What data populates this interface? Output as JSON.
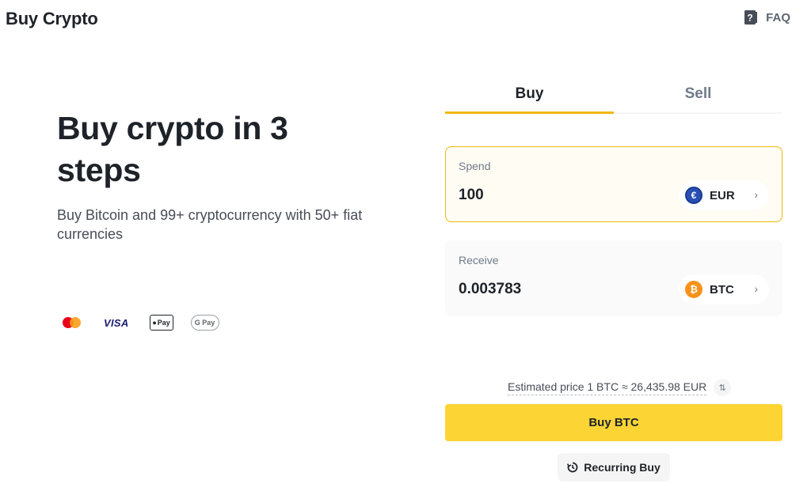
{
  "header": {
    "title": "Buy Crypto",
    "faq_label": "FAQ",
    "faq_icon": "help-book-icon"
  },
  "hero": {
    "title": "Buy crypto in 3 steps",
    "subtitle": "Buy Bitcoin and 99+ cryptocurrency with 50+ fiat currencies"
  },
  "payment_methods": [
    {
      "name": "mastercard-icon"
    },
    {
      "name": "visa-icon",
      "label": "VISA"
    },
    {
      "name": "apple-pay-icon",
      "label": "Pay"
    },
    {
      "name": "google-pay-icon",
      "label": "G Pay"
    }
  ],
  "trade": {
    "tabs": [
      {
        "label": "Buy",
        "active": true
      },
      {
        "label": "Sell",
        "active": false
      }
    ],
    "spend": {
      "label": "Spend",
      "value": "100",
      "currency": "EUR",
      "currency_icon": "euro-coin-icon",
      "currency_symbol": "€"
    },
    "receive": {
      "label": "Receive",
      "value": "0.003783",
      "currency": "BTC",
      "currency_icon": "bitcoin-coin-icon",
      "currency_symbol": "₿"
    },
    "estimated_price": "Estimated price 1 BTC ≈ 26,435.98 EUR",
    "swap_icon": "swap-arrows-icon",
    "buy_button": "Buy BTC",
    "recurring_button": "Recurring Buy",
    "recurring_icon": "recurring-clock-icon"
  },
  "colors": {
    "accent": "#f0b90b",
    "button": "#fcd535",
    "text": "#1e2329",
    "muted": "#707a8a"
  }
}
